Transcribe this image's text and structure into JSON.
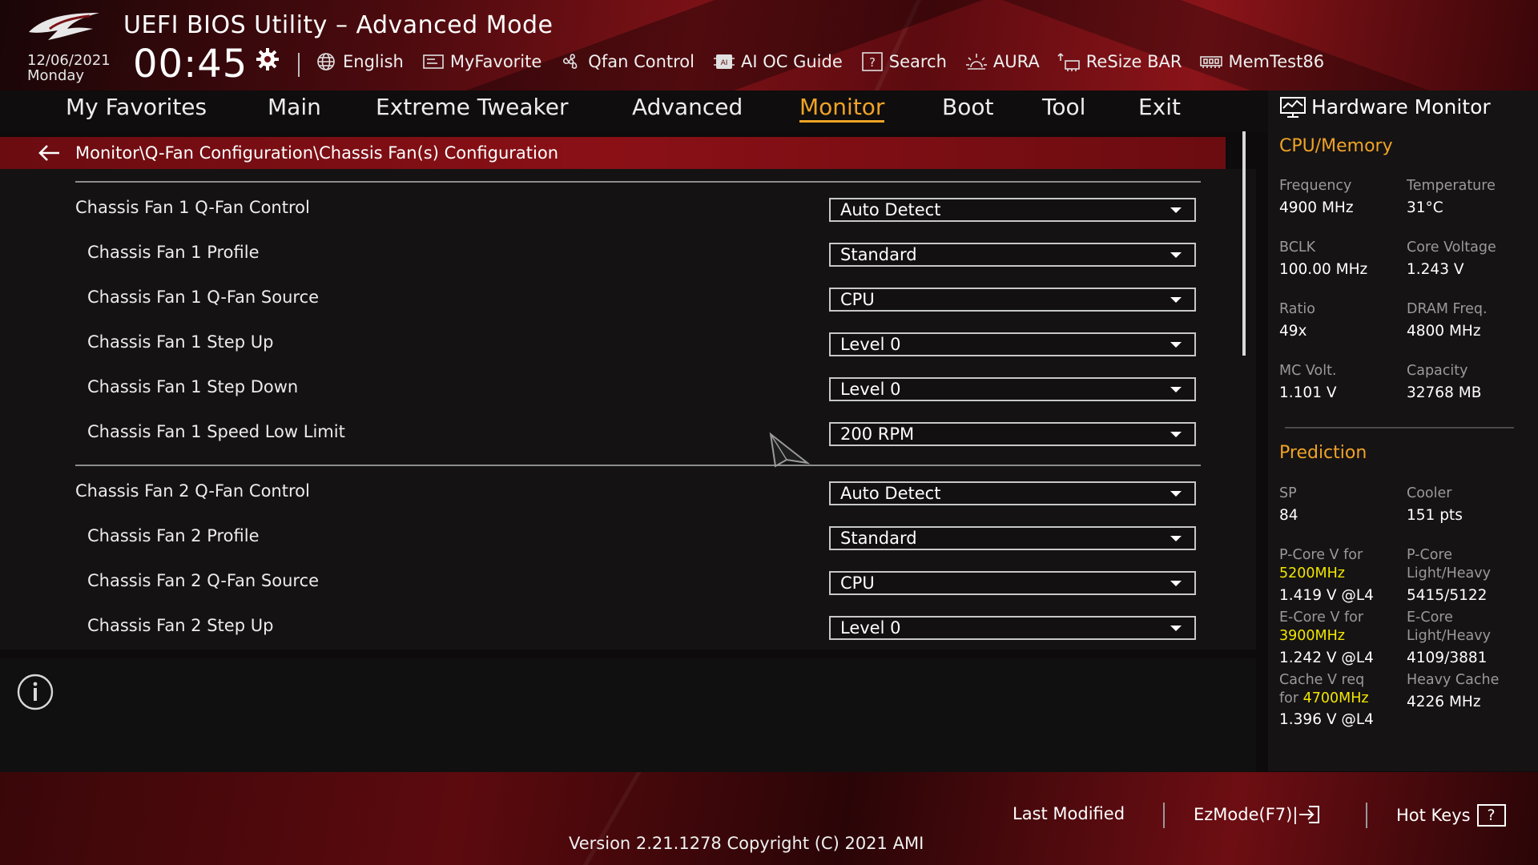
{
  "header": {
    "title": "UEFI BIOS Utility – Advanced Mode",
    "date": "12/06/2021",
    "weekday": "Monday",
    "time": "00:45"
  },
  "toolbar": [
    {
      "label": "English",
      "icon": "globe-icon"
    },
    {
      "label": "MyFavorite",
      "icon": "favorite-icon"
    },
    {
      "label": "Qfan Control",
      "icon": "fan-icon"
    },
    {
      "label": "AI OC Guide",
      "icon": "ai-chip-icon"
    },
    {
      "label": "Search",
      "icon": "search-help-icon"
    },
    {
      "label": "AURA",
      "icon": "aura-icon"
    },
    {
      "label": "ReSize BAR",
      "icon": "resize-bar-icon"
    },
    {
      "label": "MemTest86",
      "icon": "memory-icon"
    }
  ],
  "nav": {
    "items": [
      "My Favorites",
      "Main",
      "Extreme Tweaker",
      "Advanced",
      "Monitor",
      "Boot",
      "Tool",
      "Exit"
    ],
    "active": "Monitor"
  },
  "breadcrumb": "Monitor\\Q-Fan Configuration\\Chassis Fan(s) Configuration",
  "settings": [
    {
      "label": "Chassis Fan 1 Q-Fan Control",
      "value": "Auto Detect"
    },
    {
      "label": "Chassis Fan 1 Profile",
      "value": "Standard"
    },
    {
      "label": "Chassis Fan 1 Q-Fan Source",
      "value": "CPU"
    },
    {
      "label": "Chassis Fan 1 Step Up",
      "value": "Level 0"
    },
    {
      "label": "Chassis Fan 1 Step Down",
      "value": "Level 0"
    },
    {
      "label": "Chassis Fan 1 Speed Low Limit",
      "value": "200 RPM"
    },
    {
      "label": "Chassis Fan 2 Q-Fan Control",
      "value": "Auto Detect"
    },
    {
      "label": "Chassis Fan 2 Profile",
      "value": "Standard"
    },
    {
      "label": "Chassis Fan 2 Q-Fan Source",
      "value": "CPU"
    },
    {
      "label": "Chassis Fan 2 Step Up",
      "value": "Level 0"
    }
  ],
  "hardware_monitor": {
    "title": "Hardware Monitor",
    "cpu_memory": {
      "section": "CPU/Memory",
      "frequency_label": "Frequency",
      "frequency": "4900 MHz",
      "temperature_label": "Temperature",
      "temperature": "31°C",
      "bclk_label": "BCLK",
      "bclk": "100.00 MHz",
      "core_voltage_label": "Core Voltage",
      "core_voltage": "1.243 V",
      "ratio_label": "Ratio",
      "ratio": "49x",
      "dram_freq_label": "DRAM Freq.",
      "dram_freq": "4800 MHz",
      "mc_volt_label": "MC Volt.",
      "mc_volt": "1.101 V",
      "capacity_label": "Capacity",
      "capacity": "32768 MB"
    },
    "prediction": {
      "section": "Prediction",
      "sp_label": "SP",
      "sp": "84",
      "cooler_label": "Cooler",
      "cooler": "151 pts",
      "pcore_v_label": "P-Core V for",
      "pcore_v_freq": "5200MHz",
      "pcore_v": "1.419 V @L4",
      "pcore_lh_label_1": "P-Core",
      "pcore_lh_label_2": "Light/Heavy",
      "pcore_lh": "5415/5122",
      "ecore_v_label": "E-Core V for",
      "ecore_v_freq": "3900MHz",
      "ecore_v": "1.242 V @L4",
      "ecore_lh_label_1": "E-Core",
      "ecore_lh_label_2": "Light/Heavy",
      "ecore_lh": "4109/3881",
      "cache_v_label_1": "Cache V req",
      "cache_v_label_2": "for",
      "cache_v_freq": "4700MHz",
      "cache_v": "1.396 V @L4",
      "heavy_cache_label": "Heavy Cache",
      "heavy_cache": "4226 MHz"
    }
  },
  "footer": {
    "last_modified": "Last Modified",
    "ezmode": "EzMode(F7)|",
    "hotkeys": "Hot Keys",
    "hotkeys_icon_text": "?",
    "version": "Version 2.21.1278 Copyright (C) 2021 AMI"
  },
  "colors": {
    "accent": "#f0a326",
    "highlight": "#f2e600",
    "brand_red": "#8a1016"
  }
}
